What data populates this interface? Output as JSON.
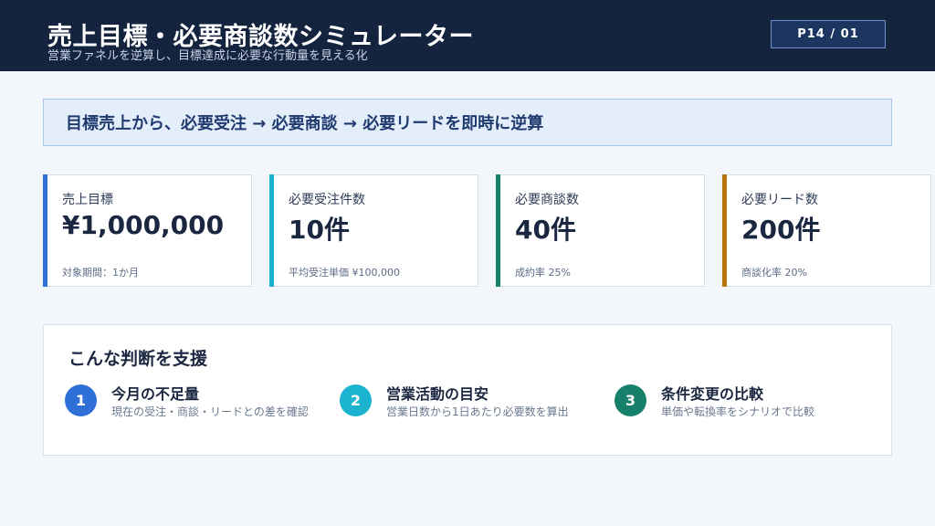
{
  "header": {
    "title": "売上目標・必要商談数シミュレーター",
    "subtitle": "営業ファネルを逆算し、目標達成に必要な行動量を見える化",
    "page_badge": "P14 / 01"
  },
  "banner": {
    "text": "目標売上から、必要受注 → 必要商談 → 必要リードを即時に逆算"
  },
  "cards": [
    {
      "label": "売上目標",
      "value": "¥1,000,000",
      "note": "対象期間：1か月",
      "accent": "#2f6fd8"
    },
    {
      "label": "必要受注件数",
      "value": "10件",
      "note": "平均受注単価 ¥100,000",
      "accent": "#1bb3cf"
    },
    {
      "label": "必要商談数",
      "value": "40件",
      "note": "成約率 25%",
      "accent": "#16806a"
    },
    {
      "label": "必要リード数",
      "value": "200件",
      "note": "商談化率 20%",
      "accent": "#b8730f"
    }
  ],
  "support": {
    "title": "こんな判断を支援",
    "steps": [
      {
        "num": "1",
        "title": "今月の不足量",
        "desc": "現在の受注・商談・リードとの差を確認",
        "color": "#2f6fd8"
      },
      {
        "num": "2",
        "title": "営業活動の目安",
        "desc": "営業日数から1日あたり必要数を算出",
        "color": "#1bb3cf"
      },
      {
        "num": "3",
        "title": "条件変更の比較",
        "desc": "単価や転換率をシナリオで比較",
        "color": "#16806a"
      }
    ]
  }
}
